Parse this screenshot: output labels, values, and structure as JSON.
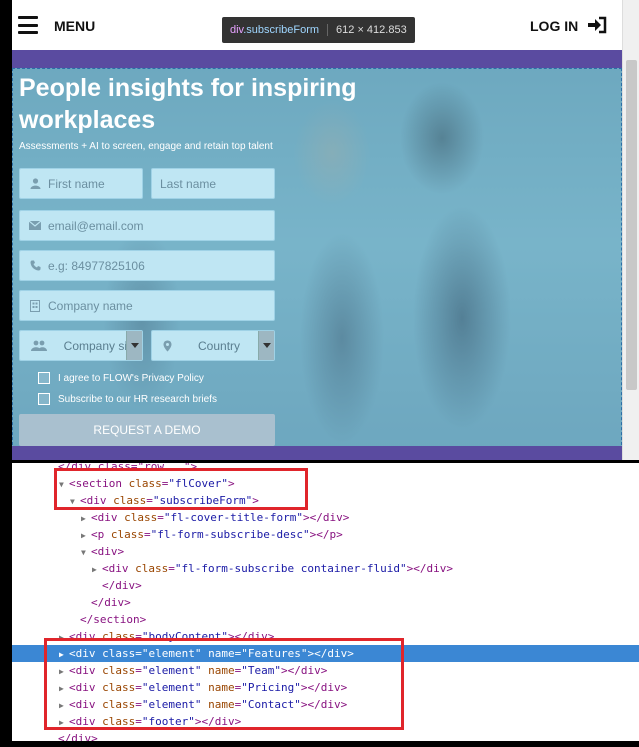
{
  "navbar": {
    "menu_label": "MENU",
    "login_label": "LOG IN",
    "icons": {
      "menu": "hamburger-icon",
      "login": "sign-in-icon"
    }
  },
  "inspector_tooltip": {
    "element": "div",
    "class": ".subscribeForm",
    "dimensions": "612 × 412.853"
  },
  "hero": {
    "title": "People insights for inspiring workplaces",
    "description": "Assessments + AI to screen, engage and retain top talent",
    "form": {
      "first_name_placeholder": "First name",
      "last_name_placeholder": "Last name",
      "email_placeholder": "email@email.com",
      "phone_placeholder": "e.g: 84977825106",
      "company_placeholder": "Company name",
      "company_size_selected": "Company si",
      "country_selected": "Country",
      "privacy_label": "I agree to FLOW's Privacy Policy",
      "subscribe_label": "Subscribe to our HR research briefs",
      "submit_label": "REQUEST A DEMO"
    },
    "colors": {
      "overlay": "#6eb4cd",
      "band": "#5a4ba0",
      "field": "#bfe6f3",
      "button": "#a9c0cf"
    }
  },
  "devtools": {
    "lines": [
      {
        "tri": "",
        "indent": 0,
        "parts": [
          [
            "tag",
            "</div class=\"row...\">"
          ]
        ]
      },
      {
        "tri": "▼",
        "indent": 1,
        "parts": [
          [
            "tag",
            "<section"
          ],
          [
            "sp",
            " "
          ],
          [
            "attr",
            "class"
          ],
          [
            "tag",
            "="
          ],
          [
            "val",
            "\"flCover\""
          ],
          [
            "tag",
            ">"
          ]
        ]
      },
      {
        "tri": "▼",
        "indent": 2,
        "parts": [
          [
            "tag",
            "<div"
          ],
          [
            "sp",
            " "
          ],
          [
            "attr",
            "class"
          ],
          [
            "tag",
            "="
          ],
          [
            "val",
            "\"subscribeForm\""
          ],
          [
            "tag",
            ">"
          ]
        ]
      },
      {
        "tri": "▶",
        "indent": 3,
        "parts": [
          [
            "tag",
            "<div"
          ],
          [
            "sp",
            " "
          ],
          [
            "attr",
            "class"
          ],
          [
            "tag",
            "="
          ],
          [
            "val",
            "\"fl-cover-title-form\""
          ],
          [
            "tag",
            "></div>"
          ]
        ]
      },
      {
        "tri": "▶",
        "indent": 3,
        "parts": [
          [
            "tag",
            "<p"
          ],
          [
            "sp",
            " "
          ],
          [
            "attr",
            "class"
          ],
          [
            "tag",
            "="
          ],
          [
            "val",
            "\"fl-form-subscribe-desc\""
          ],
          [
            "tag",
            "></p>"
          ]
        ]
      },
      {
        "tri": "▼",
        "indent": 3,
        "parts": [
          [
            "tag",
            "<div>"
          ]
        ]
      },
      {
        "tri": "▶",
        "indent": 4,
        "parts": [
          [
            "tag",
            "<div"
          ],
          [
            "sp",
            " "
          ],
          [
            "attr",
            "class"
          ],
          [
            "tag",
            "="
          ],
          [
            "val",
            "\"fl-form-subscribe container-fluid\""
          ],
          [
            "tag",
            "></div>"
          ]
        ]
      },
      {
        "tri": "",
        "indent": 4,
        "parts": [
          [
            "tag",
            "</div>"
          ]
        ]
      },
      {
        "tri": "",
        "indent": 3,
        "parts": [
          [
            "tag",
            "</div>"
          ]
        ]
      },
      {
        "tri": "",
        "indent": 2,
        "parts": [
          [
            "tag",
            "</section>"
          ]
        ]
      },
      {
        "tri": "▶",
        "indent": 1,
        "parts": [
          [
            "tag",
            "<div"
          ],
          [
            "sp",
            " "
          ],
          [
            "attr",
            "class"
          ],
          [
            "tag",
            "="
          ],
          [
            "val",
            "\"bodyContent\""
          ],
          [
            "tag",
            "></div>"
          ]
        ]
      },
      {
        "tri": "▶",
        "indent": 1,
        "selected": true,
        "parts": [
          [
            "tag",
            "<div"
          ],
          [
            "sp",
            " "
          ],
          [
            "attr",
            "class"
          ],
          [
            "tag",
            "="
          ],
          [
            "val",
            "\"element\""
          ],
          [
            "sp",
            " "
          ],
          [
            "attr",
            "name"
          ],
          [
            "tag",
            "="
          ],
          [
            "val",
            "\"Features\""
          ],
          [
            "tag",
            "></div>"
          ]
        ]
      },
      {
        "tri": "▶",
        "indent": 1,
        "parts": [
          [
            "tag",
            "<div"
          ],
          [
            "sp",
            " "
          ],
          [
            "attr",
            "class"
          ],
          [
            "tag",
            "="
          ],
          [
            "val",
            "\"element\""
          ],
          [
            "sp",
            " "
          ],
          [
            "attr",
            "name"
          ],
          [
            "tag",
            "="
          ],
          [
            "val",
            "\"Team\""
          ],
          [
            "tag",
            "></div>"
          ]
        ]
      },
      {
        "tri": "▶",
        "indent": 1,
        "parts": [
          [
            "tag",
            "<div"
          ],
          [
            "sp",
            " "
          ],
          [
            "attr",
            "class"
          ],
          [
            "tag",
            "="
          ],
          [
            "val",
            "\"element\""
          ],
          [
            "sp",
            " "
          ],
          [
            "attr",
            "name"
          ],
          [
            "tag",
            "="
          ],
          [
            "val",
            "\"Pricing\""
          ],
          [
            "tag",
            "></div>"
          ]
        ]
      },
      {
        "tri": "▶",
        "indent": 1,
        "parts": [
          [
            "tag",
            "<div"
          ],
          [
            "sp",
            " "
          ],
          [
            "attr",
            "class"
          ],
          [
            "tag",
            "="
          ],
          [
            "val",
            "\"element\""
          ],
          [
            "sp",
            " "
          ],
          [
            "attr",
            "name"
          ],
          [
            "tag",
            "="
          ],
          [
            "val",
            "\"Contact\""
          ],
          [
            "tag",
            "></div>"
          ]
        ]
      },
      {
        "tri": "▶",
        "indent": 1,
        "parts": [
          [
            "tag",
            "<div"
          ],
          [
            "sp",
            " "
          ],
          [
            "attr",
            "class"
          ],
          [
            "tag",
            "="
          ],
          [
            "val",
            "\"footer\""
          ],
          [
            "tag",
            "></div>"
          ]
        ]
      },
      {
        "tri": "",
        "indent": 0,
        "parts": [
          [
            "tag",
            "</div>"
          ]
        ]
      }
    ],
    "colors": {
      "tag": "#881280",
      "attr": "#994500",
      "value": "#1a1aa6",
      "selected_row": "#3b87d4",
      "highlight_box": "#e0252b"
    }
  }
}
